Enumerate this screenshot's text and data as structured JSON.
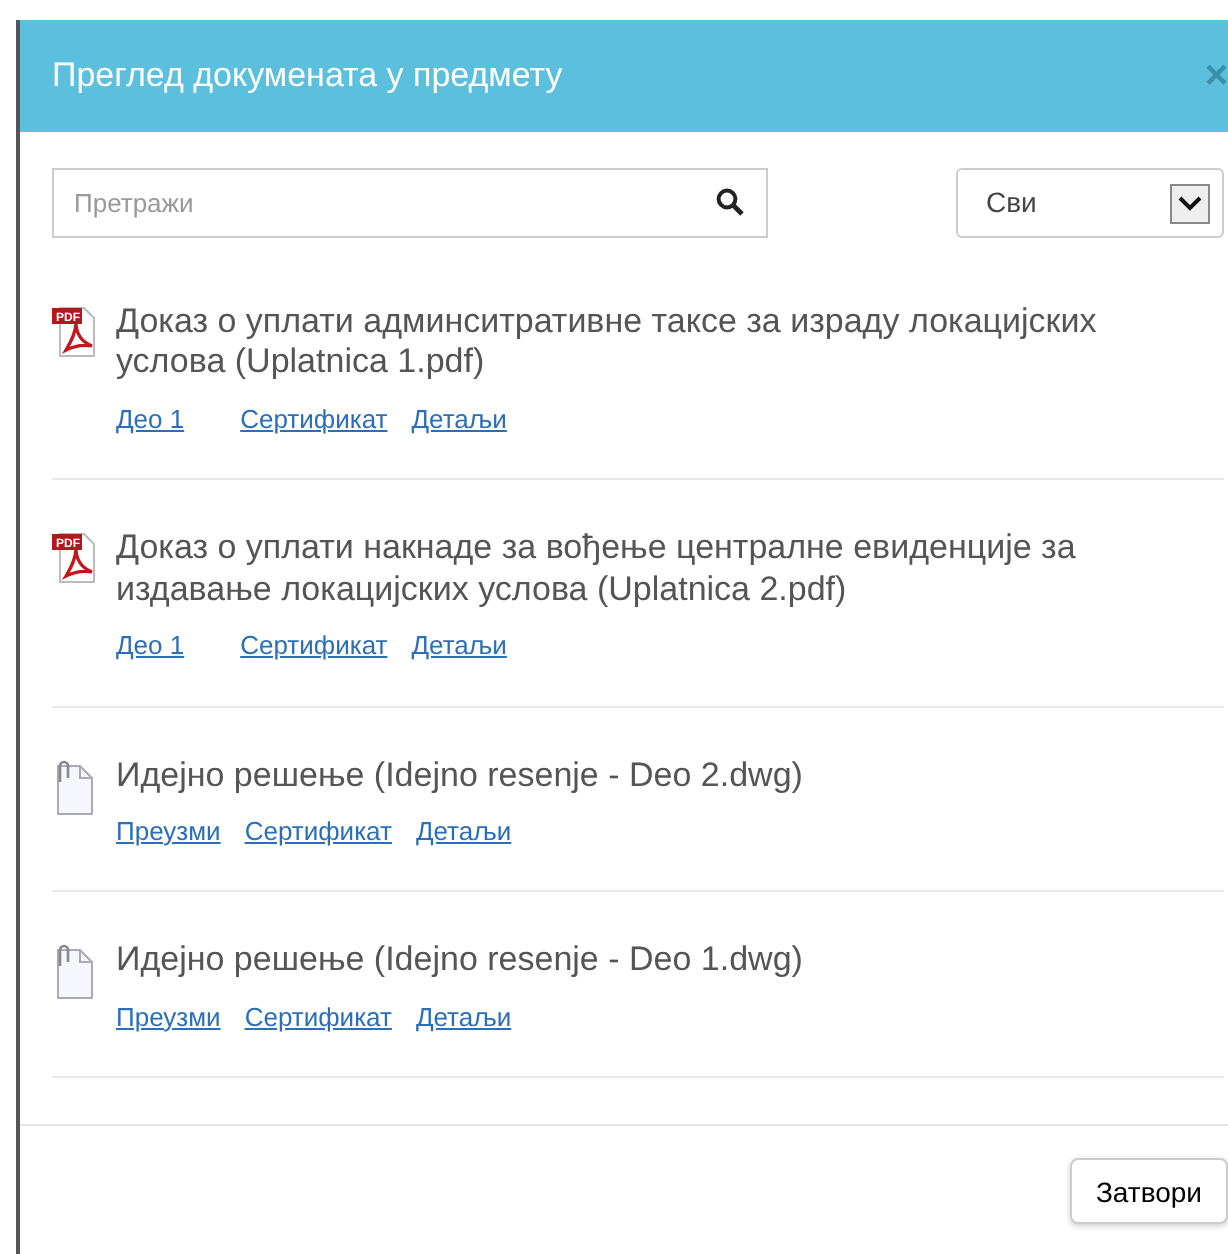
{
  "dialog": {
    "title": "Преглед докумената у предмету",
    "close": "×"
  },
  "search": {
    "placeholder": "Претражи"
  },
  "filter": {
    "value": "Сви"
  },
  "documents": [
    {
      "kind": "pdf",
      "icon_text": "PDF",
      "title": "Доказ о уплати админситративне таксе за израду локацијских услова (Uplatnica 1.pdf)",
      "links": [
        "Део 1",
        "Сертификат",
        "Детаљи"
      ]
    },
    {
      "kind": "pdf",
      "icon_text": "PDF",
      "title": "Доказ о уплати накнаде за вођење централне евиденције за издавање локацијских услова (Uplatnica 2.pdf)",
      "links": [
        "Део 1",
        "Сертификат",
        "Детаљи"
      ]
    },
    {
      "kind": "attachment",
      "title": "Идејно решење (Idejno resenje - Deo 2.dwg)",
      "links": [
        "Преузми",
        "Сертификат",
        "Детаљи"
      ]
    },
    {
      "kind": "attachment",
      "title": "Идејно решење (Idejno resenje - Deo 1.dwg)",
      "links": [
        "Преузми",
        "Сертификат",
        "Детаљи"
      ]
    }
  ],
  "footer": {
    "button": "Затвори"
  }
}
